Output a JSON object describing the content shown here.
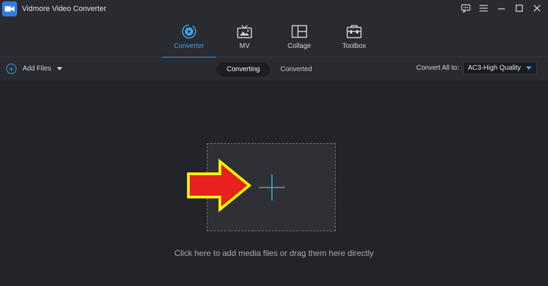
{
  "window": {
    "title": "Vidmore Video Converter",
    "logo_icon": "video-camera-icon",
    "controls": [
      "feedback-icon",
      "menu-icon",
      "minimize-icon",
      "maximize-icon",
      "close-icon"
    ]
  },
  "main_tabs": [
    {
      "label": "Converter",
      "icon": "converter-icon",
      "active": true
    },
    {
      "label": "MV",
      "icon": "mv-icon",
      "active": false
    },
    {
      "label": "Collage",
      "icon": "collage-icon",
      "active": false
    },
    {
      "label": "Toolbox",
      "icon": "toolbox-icon",
      "active": false
    }
  ],
  "toolbar": {
    "add_files_label": "Add Files",
    "subtabs": [
      {
        "label": "Converting",
        "active": true
      },
      {
        "label": "Converted",
        "active": false
      }
    ],
    "convert_all_label": "Convert All to:",
    "convert_all_value": "AC3-High Quality"
  },
  "main": {
    "drop_hint": "Click here to add media files or drag them here directly"
  },
  "colors": {
    "accent": "#3ea5ee",
    "background": "#23242a",
    "panel": "#2a2b31",
    "arrow_fill": "#e8201e",
    "arrow_outline": "#f5f500"
  }
}
